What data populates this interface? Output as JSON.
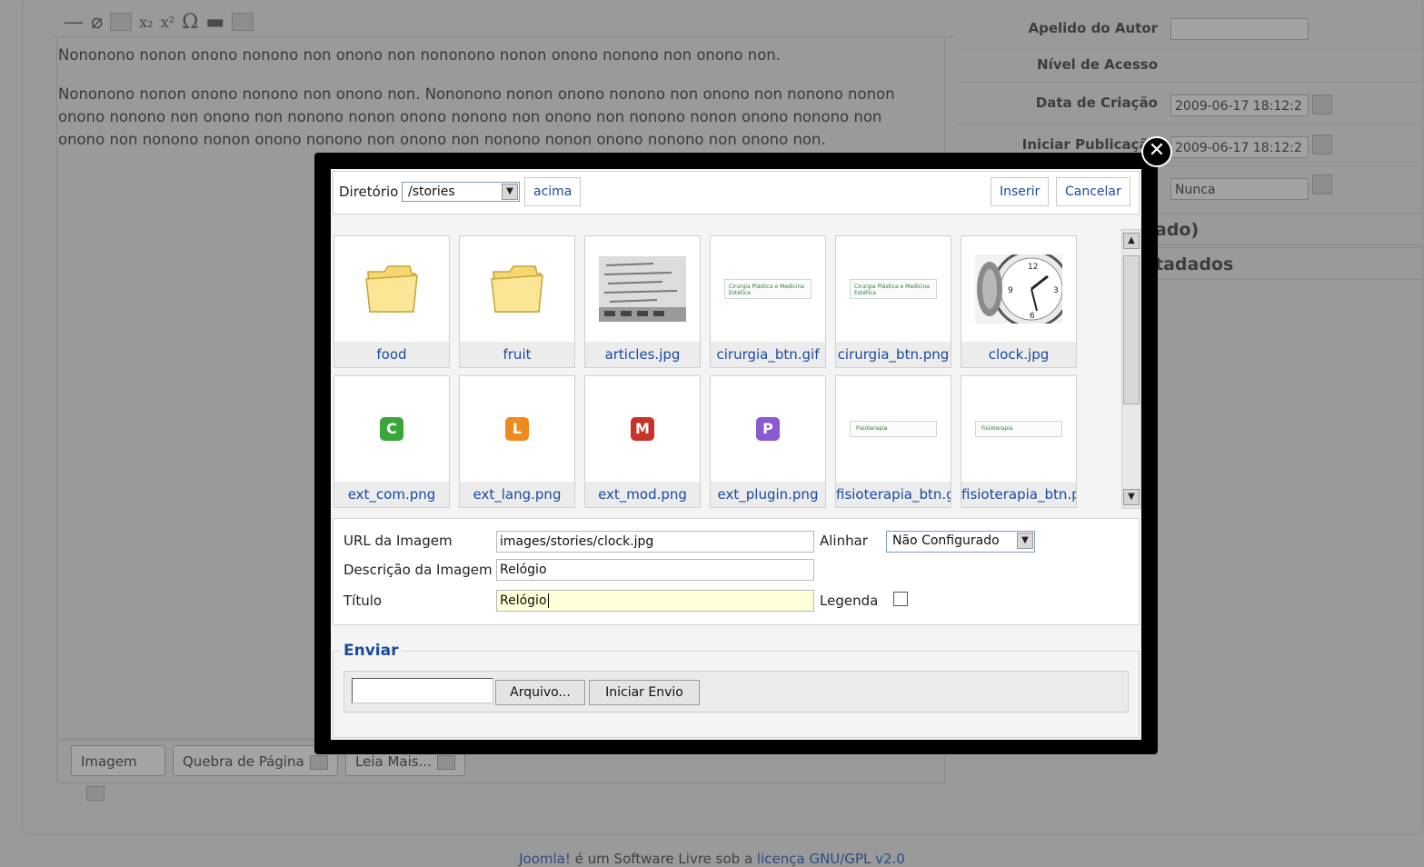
{
  "background": {
    "paragraph1": "Nononono nonon onono nonono non onono non nononono nonon onono nonono non onono non.",
    "paragraph2": "Nononono nonon onono nonono non onono non. Nononono nonon onono nonono non onono non nonono nonon onono nonono non onono non nonono nonon onono nonono non onono non nonono nonon onono nonono non onono non nonono nonon onono nonono non onono non nonono nonon onono nonono non onono non.",
    "buttons": {
      "image": "Imagem",
      "pagebreak": "Quebra de Página",
      "readmore": "Leia Mais..."
    },
    "params": [
      {
        "label": "Apelido do Autor",
        "value": ""
      },
      {
        "label": "Nível de Acesso",
        "value": ""
      },
      {
        "label": "Data de Criação",
        "value": "2009-06-17 18:12:2"
      },
      {
        "label": "Iniciar Publicação",
        "value": "2009-06-17 18:12:2"
      },
      {
        "label": "",
        "value": "Nunca"
      }
    ],
    "sections": [
      "ado)",
      "tadados"
    ],
    "footer": {
      "link1": "Joomla!",
      "middle": " é um Software Livre sob a ",
      "link2": "licença GNU/GPL v2.0"
    }
  },
  "modal": {
    "close_glyph": "✕",
    "directory_label": "Diretório",
    "directory_value": "/stories",
    "up_button": "acima",
    "insert_button": "Inserir",
    "cancel_button": "Cancelar",
    "files": [
      {
        "name": "food",
        "kind": "folder"
      },
      {
        "name": "fruit",
        "kind": "folder"
      },
      {
        "name": "articles.jpg",
        "kind": "image-text"
      },
      {
        "name": "cirurgia_btn.gif",
        "kind": "banner",
        "banner_text": "Cirurgia Plástica e Medicina Estética"
      },
      {
        "name": "cirurgia_btn.png",
        "kind": "banner",
        "banner_text": "Cirurgia Plástica e Medicina Estética"
      },
      {
        "name": "clock.jpg",
        "kind": "clock"
      },
      {
        "name": "ext_com.png",
        "kind": "ext",
        "letter": "C",
        "color": "#3aa63a"
      },
      {
        "name": "ext_lang.png",
        "kind": "ext",
        "letter": "L",
        "color": "#ef8a1f"
      },
      {
        "name": "ext_mod.png",
        "kind": "ext",
        "letter": "M",
        "color": "#c8322a"
      },
      {
        "name": "ext_plugin.png",
        "kind": "ext",
        "letter": "P",
        "color": "#8a5ad0"
      },
      {
        "name": "fisioterapia_btn.g",
        "kind": "banner",
        "banner_text": "Fisioterapia"
      },
      {
        "name": "fisioterapia_btn.p",
        "kind": "banner",
        "banner_text": "Fisioterapia"
      }
    ],
    "url_label": "URL da Imagem",
    "url_value": "images/stories/clock.jpg",
    "desc_label": "Descrição da Imagem",
    "desc_value": "Relógio",
    "title_label": "Título",
    "title_value": "Relógio",
    "align_label": "Alinhar",
    "align_value": "Não Configurado",
    "caption_label": "Legenda",
    "caption_checked": false,
    "upload_legend": "Enviar",
    "browse_button": "Arquivo...",
    "start_upload_button": "Iniciar Envio"
  }
}
